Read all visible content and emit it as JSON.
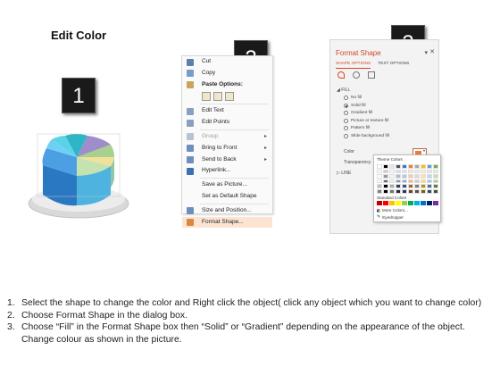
{
  "heading": "Edit Color",
  "badges": [
    "1",
    "2",
    "3"
  ],
  "context_menu": {
    "items_top": [
      {
        "label": "Cut",
        "icon": "scissors-icon",
        "color": "#5b7fb0"
      },
      {
        "label": "Copy",
        "icon": "copy-icon",
        "color": "#7a9cc9"
      }
    ],
    "paste_label": "Paste Options:",
    "items_bottom": [
      {
        "label": "Edit Text",
        "icon": "edit-text-icon",
        "color": "#8aa0bf",
        "disabled": false,
        "arrow": false
      },
      {
        "label": "Edit Points",
        "icon": "edit-points-icon",
        "color": "#8aa0bf",
        "disabled": false,
        "arrow": false
      },
      {
        "label": "Group",
        "icon": "group-icon",
        "color": "#b7c3d4",
        "disabled": true,
        "arrow": true
      },
      {
        "label": "Bring to Front",
        "icon": "bring-front-icon",
        "color": "#6e8fbd",
        "disabled": false,
        "arrow": true
      },
      {
        "label": "Send to Back",
        "icon": "send-back-icon",
        "color": "#6e8fbd",
        "disabled": false,
        "arrow": true
      },
      {
        "label": "Hyperlink...",
        "icon": "hyperlink-icon",
        "color": "#3e6fb5",
        "disabled": false,
        "arrow": false
      },
      {
        "label": "Save as Picture...",
        "icon": "",
        "color": "",
        "disabled": false,
        "arrow": false
      },
      {
        "label": "Set as Default Shape",
        "icon": "",
        "color": "",
        "disabled": false,
        "arrow": false
      },
      {
        "label": "Size and Position...",
        "icon": "size-position-icon",
        "color": "#6e8fbd",
        "disabled": false,
        "arrow": false
      },
      {
        "label": "Format Shape...",
        "icon": "format-shape-icon",
        "color": "#d9883f",
        "disabled": false,
        "arrow": false,
        "highlight": true
      }
    ]
  },
  "format_pane": {
    "title": "Format Shape",
    "tab_shape": "SHAPE OPTIONS",
    "tab_text": "TEXT OPTIONS",
    "fill_section": "FILL",
    "fill_options": [
      "No fill",
      "Solid fill",
      "Gradient fill",
      "Picture or texture fill",
      "Pattern fill",
      "Slide background fill"
    ],
    "fill_selected": "Solid fill",
    "color_label": "Color",
    "transparency_label": "Transparency",
    "line_section": "LINE",
    "color_swatch": "#e8803a"
  },
  "color_dropdown": {
    "theme_label": "Theme Colors",
    "standard_label": "Standard Colors",
    "more_colors": "More Colors...",
    "eyedropper": "Eyedropper",
    "theme_top": [
      "#ffffff",
      "#000000",
      "#e7e6e6",
      "#44546a",
      "#4472c4",
      "#ed7d31",
      "#a5a5a5",
      "#ffc000",
      "#5b9bd5",
      "#70ad47"
    ],
    "standard": [
      "#c00000",
      "#ff0000",
      "#ffc000",
      "#ffff00",
      "#92d050",
      "#00b050",
      "#00b0f0",
      "#0070c0",
      "#002060",
      "#7030a0"
    ]
  },
  "instructions": [
    {
      "num": "1.",
      "text": "Select the shape to change the color and Right click the object( click any object which you want to change color)"
    },
    {
      "num": "2.",
      "text": "Choose Format Shape in the dialog box."
    },
    {
      "num": "3.",
      "text": "Choose “Fill” in the Format Shape box then “Solid” or “Gradient” depending on the appearance of the object. Change colour as shown in the picture."
    }
  ]
}
